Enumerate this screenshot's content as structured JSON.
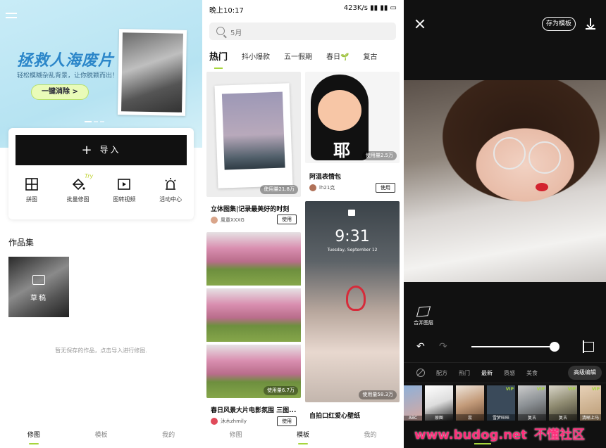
{
  "panel1": {
    "banner": {
      "title": "拯救人海废片",
      "subtitle": "轻松模糊杂乱背景，让你脱颖而出！",
      "button": "一键消除 >"
    },
    "import_label": "导入",
    "tools": [
      {
        "label": "拼图",
        "icon": "grid-icon"
      },
      {
        "label": "批量修图",
        "icon": "bucket-icon"
      },
      {
        "label": "图转视频",
        "icon": "video-icon"
      },
      {
        "label": "活动中心",
        "icon": "alarm-icon"
      }
    ],
    "try_badge": "Try",
    "works_title": "作品集",
    "draft_label": "草稿",
    "empty_message": "暂无保存的作品，点击导入进行修图.",
    "tabs": [
      "修图",
      "模板",
      "我的"
    ]
  },
  "panel2": {
    "status": {
      "time": "晚上10:17",
      "net": "423K/s"
    },
    "search_placeholder": "5月",
    "categories": [
      "热门",
      "抖小爆款",
      "五一假期",
      "春日🌱",
      "复古"
    ],
    "tiles": [
      {
        "title": "立体图集|记录最美好的时刻",
        "author": "風童XXXG",
        "usage": "使用量21.8万"
      },
      {
        "title": "阿温表情包",
        "author": "lh21克",
        "usage": "使用量2.5万"
      },
      {
        "title": "春日风景大片电影氛围 三图...",
        "author": "沐木zhmily",
        "usage": "使用量6.7万"
      },
      {
        "title": "自拍口红爱心壁纸",
        "author": "",
        "usage": "使用量58.3万"
      }
    ],
    "lock_time": "9:31",
    "lock_date": "Tuesday, September 12",
    "sticker_text": "耶",
    "use_button": "使用",
    "tabs": [
      "修图",
      "模板",
      "我的"
    ]
  },
  "panel3": {
    "save_template": "存为模板",
    "merge_layers": "合并图层",
    "slider_value": 0.95,
    "filters": [
      "配方",
      "热门",
      "最新",
      "质感",
      "美食"
    ],
    "active_filter": "最新",
    "advanced_edit": "高级编辑",
    "thumbnails": [
      {
        "label": "ABC"
      },
      {
        "label": "原图"
      },
      {
        "label": "蕊"
      },
      {
        "label": "雪梦旺旺",
        "vip": "VIP"
      },
      {
        "label": "复古",
        "vip": "VIP"
      },
      {
        "label": "复古",
        "vip": "VIP"
      },
      {
        "label": "清晰上马",
        "vip": "VIP"
      }
    ],
    "watermark_url": "www.budog.net",
    "watermark_cn": "不懂社区"
  },
  "colors": {
    "accent": "#a6d63c",
    "banner_title": "#2b86c9",
    "watermark": "#ff2d7a"
  }
}
